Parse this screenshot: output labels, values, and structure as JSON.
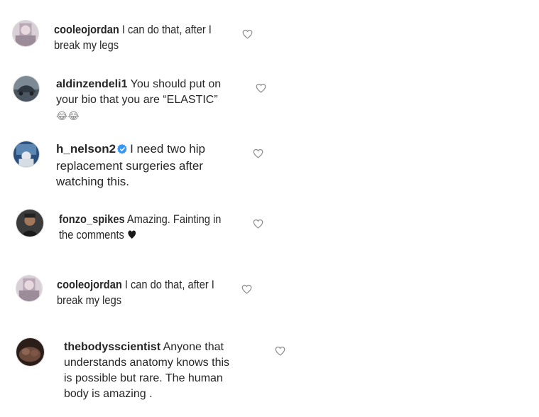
{
  "comments": [
    {
      "avatar": "avatar-cooleojordan",
      "username": "cooleojordan",
      "text_line1": "I can do that, after I",
      "text_line2": "break my legs",
      "like_icon": "heart-outline-icon"
    },
    {
      "avatar": "avatar-aldinzendeli1",
      "username": "aldinzendeli1",
      "text_line1": "You should put on",
      "text_line2": "your bio that you are “ELASTIC”",
      "emoji": "😂😂",
      "like_icon": "heart-outline-icon"
    },
    {
      "avatar": "avatar-h_nelson2",
      "username": "h_nelson2",
      "verified_icon": "verified-badge-icon",
      "text_line1": "I need two hip",
      "text_line2": "replacement surgeries after",
      "text_line3": "watching this.",
      "like_icon": "heart-outline-icon"
    },
    {
      "avatar": "avatar-fonzo_spikes",
      "username": "fonzo_spikes",
      "text_line1": "Amazing. Fainting in",
      "text_line2": "the comments",
      "trailing_icon": "black-heart-icon",
      "like_icon": "heart-outline-icon"
    },
    {
      "avatar": "avatar-cooleojordan",
      "username": "cooleojordan",
      "text_line1": "I can do that, after I",
      "text_line2": "break my legs",
      "like_icon": "heart-outline-icon"
    },
    {
      "avatar": "avatar-thebodysscientist",
      "username": "thebodysscientist",
      "text_line1": "Anyone that",
      "text_line2": "understands anatomy knows this",
      "text_line3": "is possible but rare. The human",
      "text_line4": "body is amazing .",
      "like_icon": "heart-outline-icon"
    }
  ],
  "colors": {
    "text": "#262626",
    "verified_blue": "#3897f0",
    "heart_outline": "#8e8e8e"
  }
}
